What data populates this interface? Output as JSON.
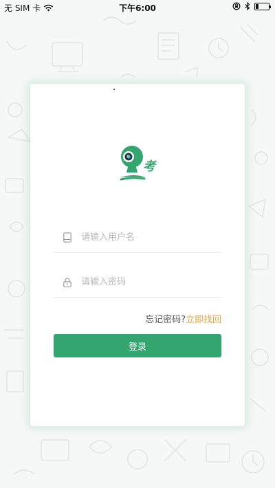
{
  "status_bar": {
    "carrier": "无 SIM 卡",
    "time": "下午6:00",
    "battery_level": 0.2,
    "icons": [
      "wifi-icon",
      "rotation-lock-icon",
      "bluetooth-icon",
      "battery-icon"
    ]
  },
  "login": {
    "logo_text": "考",
    "username_placeholder": "请输入用户名",
    "password_placeholder": "请输入密码",
    "forgot_prefix": "忘记密码?",
    "forgot_link": "立即找回",
    "login_button": "登录"
  },
  "colors": {
    "brand_green": "#33a56f",
    "link_orange": "#e8a13a",
    "background": "#f6f7f7",
    "card": "#ffffff"
  }
}
